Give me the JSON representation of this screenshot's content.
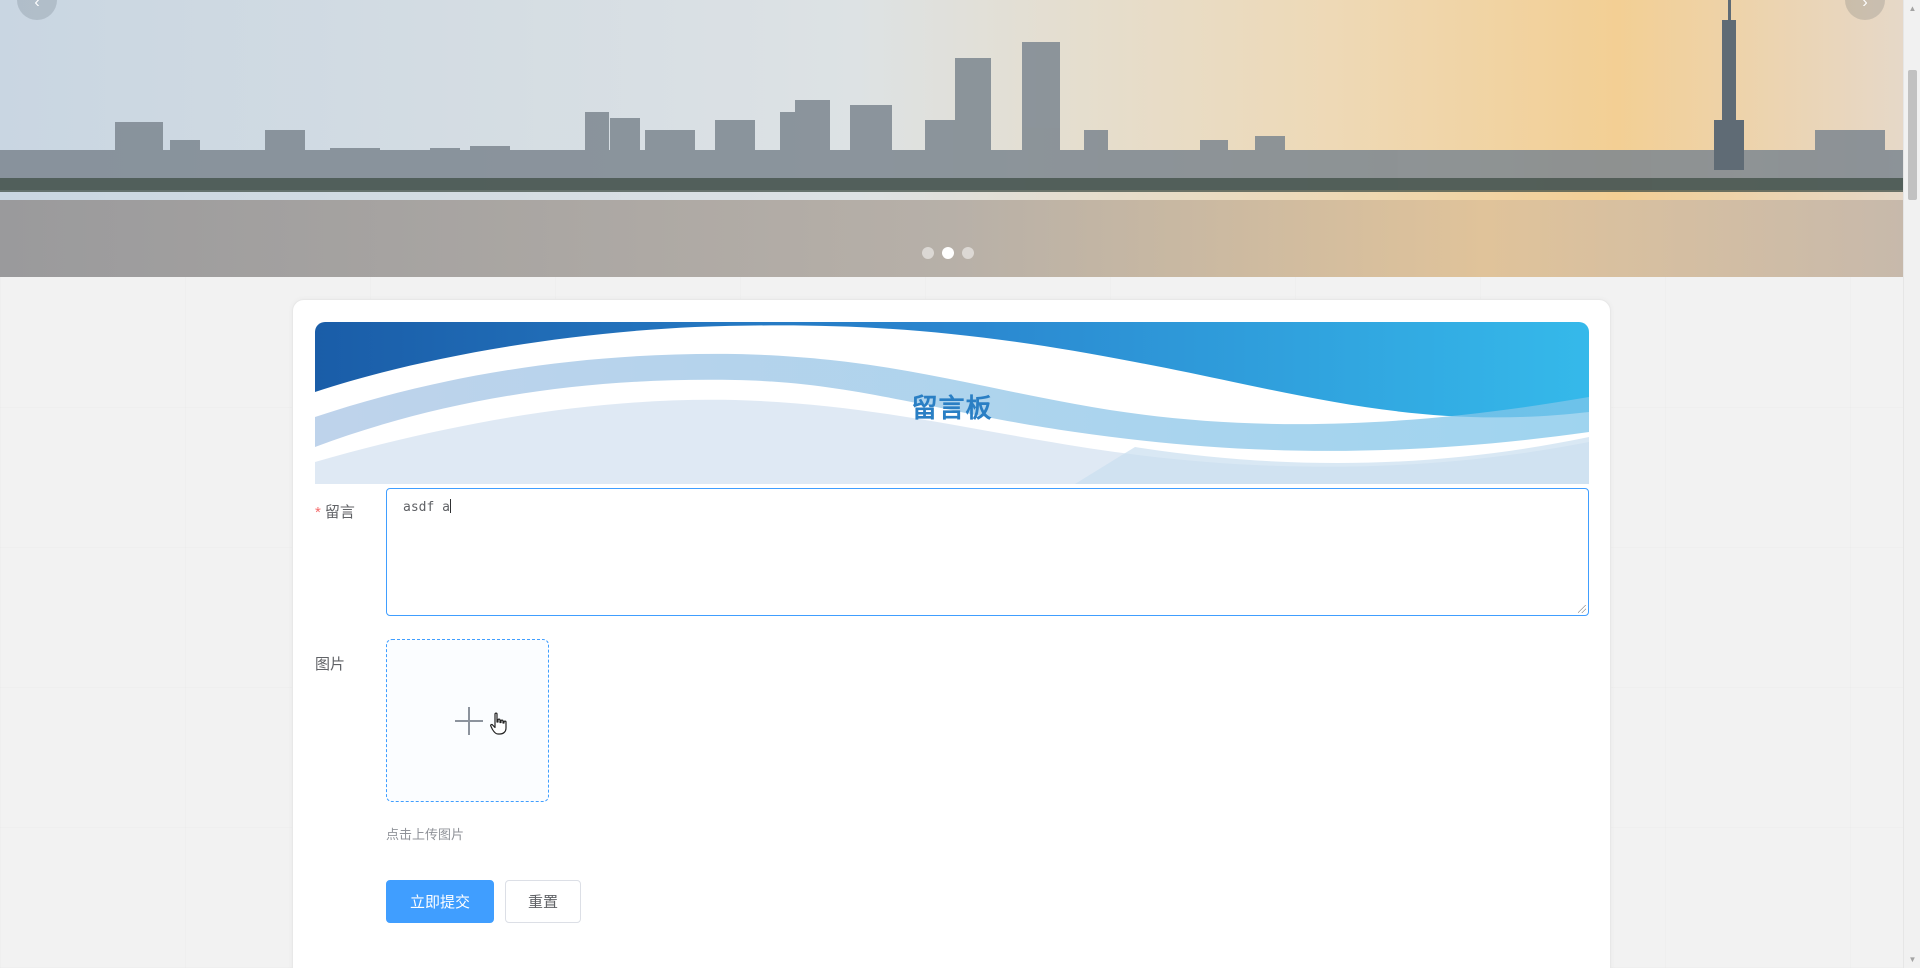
{
  "banner": {
    "prev_arrow": "‹",
    "next_arrow": "›",
    "slide_count": 3,
    "active_slide": 2
  },
  "board": {
    "title": "留言板"
  },
  "form": {
    "message": {
      "required_mark": "*",
      "label": "留言",
      "value": "asdf a"
    },
    "image": {
      "label": "图片",
      "upload_icon": "plus-icon",
      "tip": "点击上传图片"
    },
    "submit_label": "立即提交",
    "reset_label": "重置"
  },
  "colors": {
    "primary": "#409eff",
    "title": "#2a7fc4",
    "required": "#f56c6c"
  }
}
